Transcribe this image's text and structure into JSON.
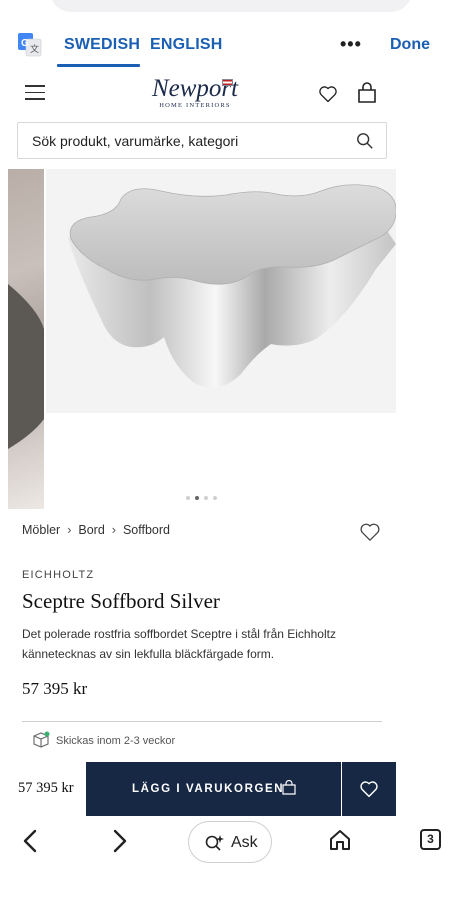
{
  "translate_bar": {
    "lang_source": "SWEDISH",
    "lang_target": "ENGLISH",
    "more": "•••",
    "done": "Done"
  },
  "header": {
    "logo_main": "Newport",
    "logo_sub": "HOME INTERIORS"
  },
  "search": {
    "placeholder": "Sök produkt, varumärke, kategori"
  },
  "gallery": {
    "slide_count": 4,
    "active_slide": 2
  },
  "breadcrumb": [
    "Möbler",
    "Bord",
    "Soffbord"
  ],
  "breadcrumb_sep": "›",
  "product": {
    "brand": "EICHHOLTZ",
    "title": "Sceptre Soffbord Silver",
    "description": "Det polerade rostfria soffbordet Sceptre i stål från Eichholtz kännetecknas av sin lekfulla bläckfärgade form.",
    "price": "57 395 kr",
    "shipping": "Skickas inom 2-3 veckor"
  },
  "sticky": {
    "price": "57 395 kr",
    "add_to_cart": "LÄGG I VARUKORGEN"
  },
  "toolbar": {
    "ask": "Ask",
    "tab_count": "3"
  },
  "colors": {
    "accent_blue": "#1a5fb4",
    "navy": "#172844"
  }
}
